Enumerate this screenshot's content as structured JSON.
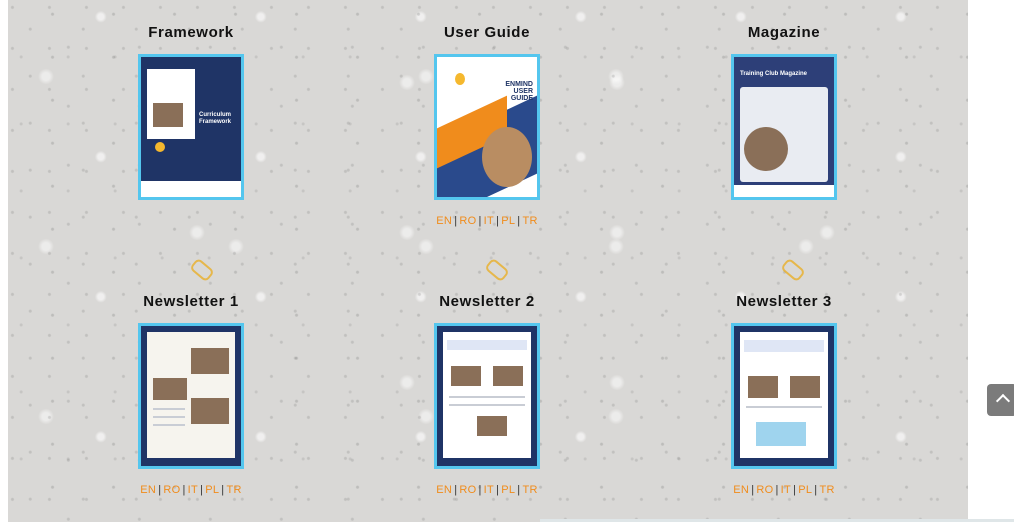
{
  "row1": [
    {
      "title": "Framework",
      "cover": "Curriculum Framework",
      "langs": []
    },
    {
      "title": "User Guide",
      "cover": "ENMIND USER GUIDE",
      "langs": [
        "EN",
        "RO",
        "IT",
        "PL",
        "TR"
      ]
    },
    {
      "title": "Magazine",
      "cover": "Training Club Magazine",
      "langs": []
    }
  ],
  "row2": [
    {
      "title": "Newsletter 1",
      "langs": [
        "EN",
        "RO",
        "IT",
        "PL",
        "TR"
      ]
    },
    {
      "title": "Newsletter 2",
      "langs": [
        "EN",
        "RO",
        "IT",
        "PL",
        "TR"
      ]
    },
    {
      "title": "Newsletter 3",
      "langs": [
        "EN",
        "RO",
        "IT",
        "PL",
        "TR"
      ]
    }
  ],
  "colors": {
    "accent": "#f08c1c",
    "cover_border": "#54c6ee",
    "navy": "#1f3466"
  },
  "icons": {
    "paperclip": "paperclip-icon",
    "back_to_top": "chevron-up-icon"
  }
}
